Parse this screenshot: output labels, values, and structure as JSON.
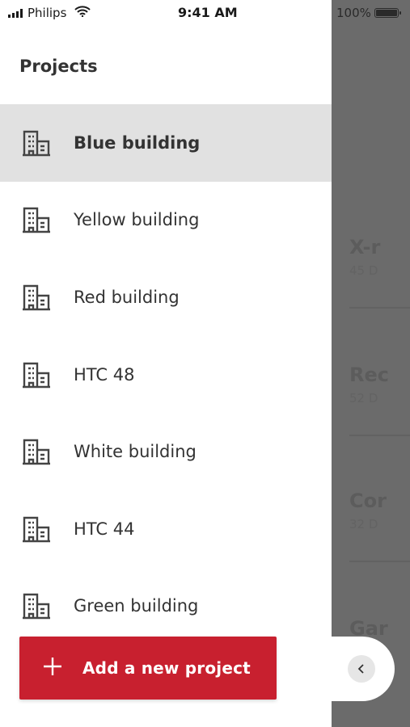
{
  "status_bar": {
    "carrier": "Philips",
    "time": "9:41 AM",
    "battery": "100%"
  },
  "background_app": {
    "cards": [
      {
        "title": "X-r",
        "subtitle": "45 D"
      },
      {
        "title": "Rec",
        "subtitle": "52 D"
      },
      {
        "title": "Cor",
        "subtitle": "32 D"
      },
      {
        "title": "Gar",
        "subtitle": ""
      }
    ]
  },
  "drawer": {
    "title": "Projects",
    "projects": [
      {
        "label": "Blue building",
        "selected": true
      },
      {
        "label": "Yellow building",
        "selected": false
      },
      {
        "label": "Red building",
        "selected": false
      },
      {
        "label": "HTC 48",
        "selected": false
      },
      {
        "label": "White building",
        "selected": false
      },
      {
        "label": "HTC 44",
        "selected": false
      },
      {
        "label": "Green building",
        "selected": false
      }
    ],
    "add_button": {
      "icon": "plus-icon",
      "label": "Add a new project"
    },
    "collapse_icon": "chevron-left-icon"
  },
  "colors": {
    "accent": "#c8202f",
    "selected_row": "#e1e1e1",
    "overlay": "#6b6b6b"
  }
}
